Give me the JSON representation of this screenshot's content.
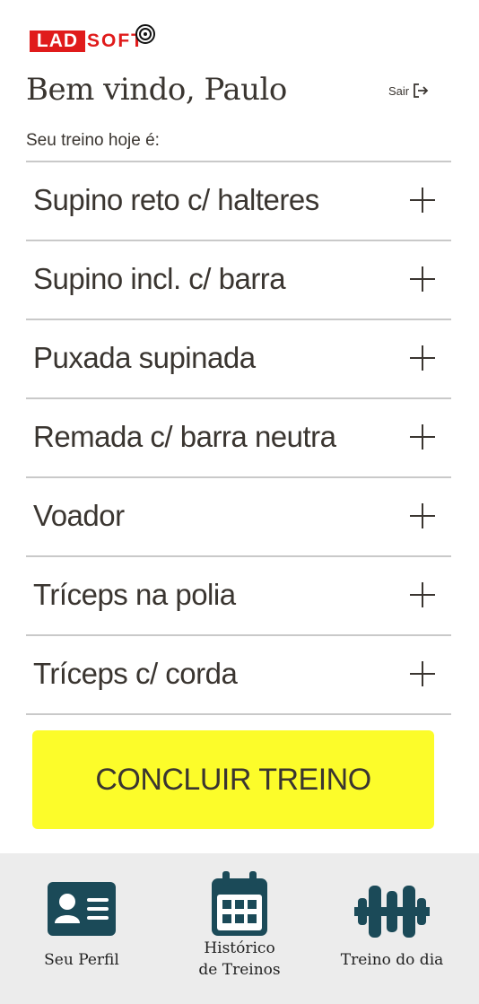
{
  "brand": {
    "logo_boxed": "LAD",
    "logo_rest": "SOFT",
    "brand_color": "#e01b1b"
  },
  "header": {
    "welcome": "Bem vindo, Paulo",
    "logout_label": "Sair",
    "logout_icon": "logout-icon"
  },
  "workout": {
    "subtitle": "Seu treino hoje é:",
    "exercises": [
      {
        "label": "Supino reto c/ halteres",
        "icon": "plus-icon"
      },
      {
        "label": "Supino incl. c/ barra",
        "icon": "plus-icon"
      },
      {
        "label": "Puxada supinada",
        "icon": "plus-icon"
      },
      {
        "label": "Remada c/ barra neutra",
        "icon": "plus-icon"
      },
      {
        "label": "Voador",
        "icon": "plus-icon"
      },
      {
        "label": "Tríceps na polia",
        "icon": "plus-icon"
      },
      {
        "label": "Tríceps c/ corda",
        "icon": "plus-icon"
      }
    ],
    "finish_label": "CONCLUIR TREINO",
    "finish_color": "#fcfc2a"
  },
  "nav": {
    "icon_color": "#1b4a58",
    "items": [
      {
        "label": "Seu Perfil",
        "icon": "id-card-icon"
      },
      {
        "label_line1": "Histórico",
        "label_line2": "de Treinos",
        "icon": "calendar-icon"
      },
      {
        "label": "Treino do dia",
        "icon": "dumbbell-icon"
      }
    ]
  }
}
